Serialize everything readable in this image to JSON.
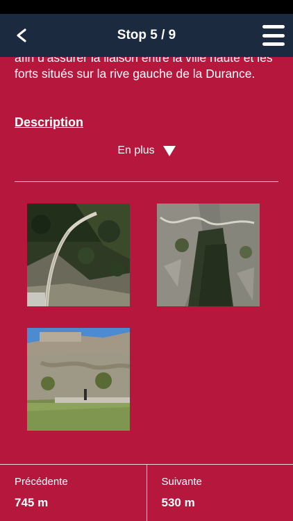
{
  "nav": {
    "title": "Stop 5 / 9",
    "back_icon": "chevron-left-icon",
    "menu_icon": "hamburger-menu-icon"
  },
  "content": {
    "body_text": "afin d’assurer la liaison entre la ville haute et les forts situés sur la rive gauche de la Durance.",
    "description_link": "Description",
    "more_label": "En plus",
    "more_icon": "triangle-down-icon"
  },
  "gallery": {
    "images": [
      {
        "subject": "mountain path along cliff"
      },
      {
        "subject": "rocky gorge with winding road"
      },
      {
        "subject": "fortress walls above meadow"
      }
    ]
  },
  "footer": {
    "previous_label": "Précédente",
    "previous_distance": "745 m",
    "next_label": "Suivante",
    "next_distance": "530 m"
  },
  "colors": {
    "background": "#b5173d",
    "navbar": "#1c2a40",
    "text": "#ffffff"
  }
}
